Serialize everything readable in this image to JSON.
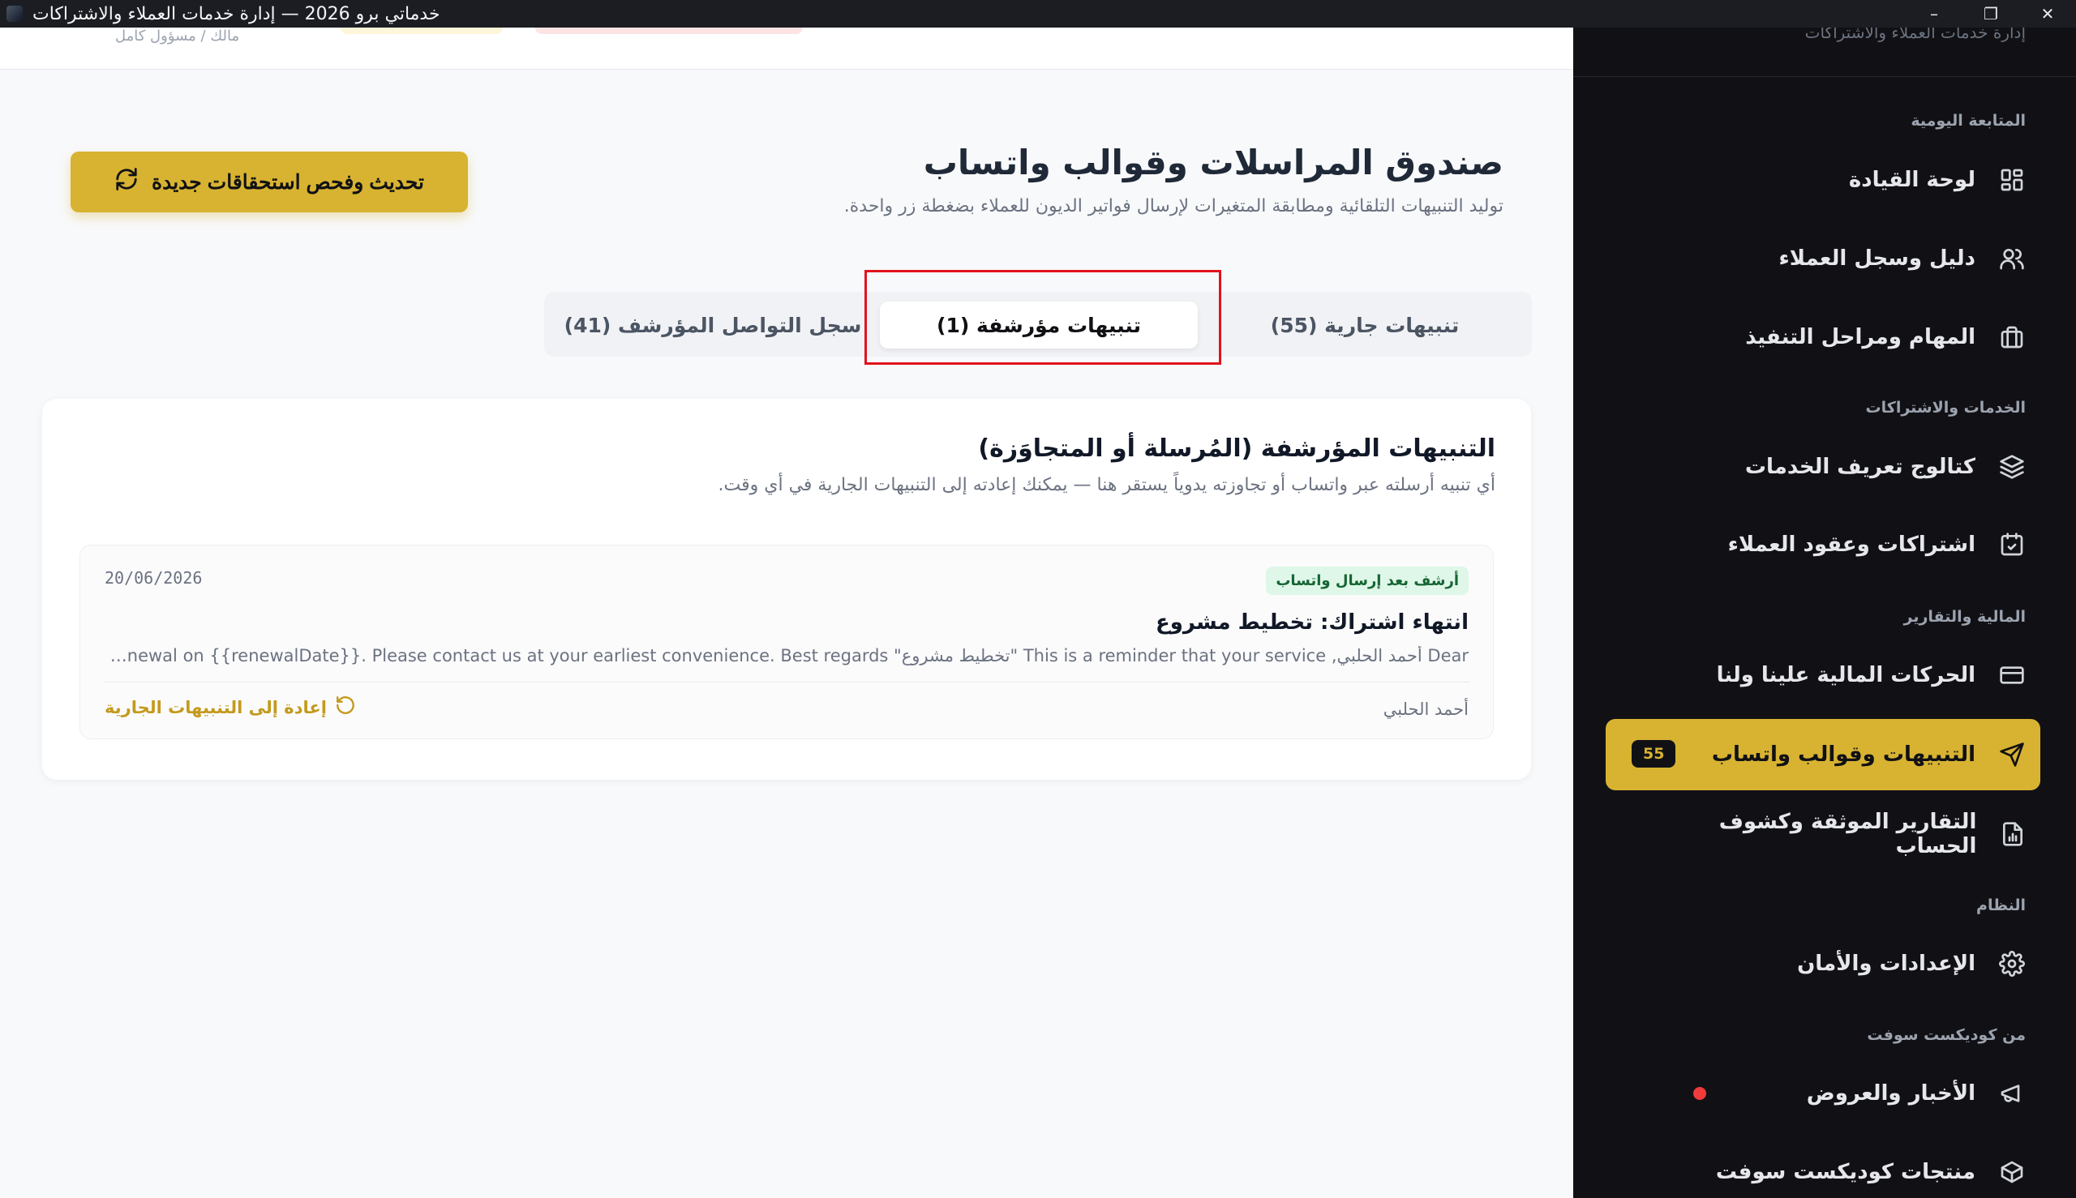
{
  "window": {
    "title": "خدماتي برو 2026 — إدارة خدمات العملاء والاشتراكات",
    "minimize": "–",
    "maximize": "❐",
    "close": "✕"
  },
  "topbar": {
    "role": "مالك / مسؤول كامل"
  },
  "sidebar": {
    "brand_sub": "إدارة خدمات العملاء والاشتراكات",
    "sections": [
      {
        "label": "المتابعة اليومية"
      },
      {
        "label": "الخدمات والاشتراكات"
      },
      {
        "label": "المالية والتقارير"
      },
      {
        "label": "النظام"
      },
      {
        "label": "من كوديكست سوفت"
      }
    ],
    "items": [
      {
        "label": "لوحة القيادة",
        "icon": "dashboard-icon"
      },
      {
        "label": "دليل وسجل العملاء",
        "icon": "users-icon"
      },
      {
        "label": "المهام ومراحل التنفيذ",
        "icon": "briefcase-icon"
      },
      {
        "label": "كتالوج تعريف الخدمات",
        "icon": "layers-icon"
      },
      {
        "label": "اشتراكات وعقود العملاء",
        "icon": "calendar-check-icon"
      },
      {
        "label": "الحركات المالية علينا ولنا",
        "icon": "credit-card-icon"
      },
      {
        "label": "التنبيهات وقوالب واتساب",
        "icon": "send-icon",
        "badge": "55"
      },
      {
        "label": "التقارير الموثقة وكشوف الحساب",
        "icon": "report-icon"
      },
      {
        "label": "الإعدادات والأمان",
        "icon": "gear-icon"
      },
      {
        "label": "الأخبار والعروض",
        "icon": "megaphone-icon"
      },
      {
        "label": "منتجات كوديكست سوفت",
        "icon": "box-icon"
      }
    ]
  },
  "header": {
    "title": "صندوق المراسلات وقوالب واتساب",
    "subtitle": "توليد التنبيهات التلقائية ومطابقة المتغيرات لإرسال فواتير الديون للعملاء بضغطة زر واحدة.",
    "refresh_label": "تحديث وفحص استحقاقات جديدة"
  },
  "tabs": [
    {
      "label": "تنبيهات جارية (55)"
    },
    {
      "label": "تنبيهات مؤرشفة (1)"
    },
    {
      "label": "سجل التواصل المؤرشف (41)"
    }
  ],
  "archived": {
    "title": "التنبيهات المؤرشفة (المُرسلة أو المتجاوَزة)",
    "subtitle": "أي تنبيه أرسلته عبر واتساب أو تجاوزته يدوياً يستقر هنا — يمكنك إعادته إلى التنبيهات الجارية في أي وقت.",
    "items": [
      {
        "tag": "أرشف بعد إرسال واتساب",
        "date": "20/06/2026",
        "title": "انتهاء اشتراك: تخطيط مشروع",
        "body": "Dear أحمد الحلبي, This is a reminder that your service \"تخطيط مشروع\" is due for renewal on {{renewalDate}}. Please contact us at your earliest convenience. Best regards,...",
        "customer": "أحمد الحلبي",
        "restore_label": "إعادة إلى التنبيهات الجارية"
      }
    ]
  },
  "colors": {
    "accent": "#d8b331",
    "sidebar_bg": "#111115",
    "highlight": "#e0131d",
    "tag_bg": "#dff7e8",
    "tag_text": "#166534"
  }
}
